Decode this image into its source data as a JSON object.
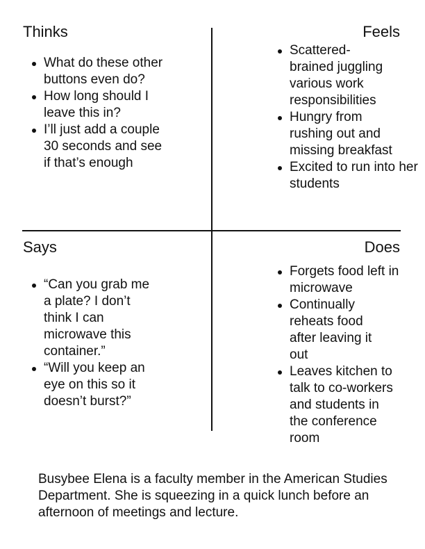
{
  "quadrants": {
    "thinks": {
      "title": "Thinks",
      "items": [
        "What do these other buttons even do?",
        "How long should I leave this in?",
        "I’ll just add a couple 30 seconds and see if that’s enough"
      ]
    },
    "feels": {
      "title": "Feels",
      "items": [
        "Scattered-brained juggling various work responsibilities",
        " Hungry from rushing out and missing breakfast",
        "Excited to run into her students"
      ]
    },
    "says": {
      "title": "Says",
      "items": [
        "“Can you grab me a plate? I don’t think I can microwave this container.”",
        "“Will you keep an eye on this so it doesn’t burst?”"
      ]
    },
    "does": {
      "title": "Does",
      "items": [
        "Forgets food left in microwave",
        "Continually reheats food after leaving it out",
        "Leaves kitchen to talk to co-workers and students in the conference room"
      ]
    }
  },
  "description": "Busybee Elena is a faculty member in the American Studies Department. She is squeezing in a quick lunch before an afternoon of meetings and lecture."
}
